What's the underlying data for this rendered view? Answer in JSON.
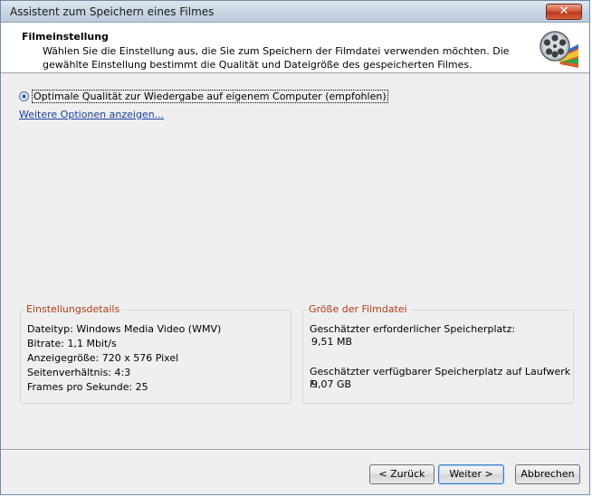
{
  "window": {
    "title": "Assistent zum Speichern eines Filmes",
    "close_label": "✕"
  },
  "header": {
    "title": "Filmeinstellung",
    "description": "Wählen Sie die Einstellung aus, die Sie zum Speichern der Filmdatei verwenden möchten. Die gewählte Einstellung bestimmt die Qualität und Dateigröße des gespeicherten Filmes."
  },
  "option": {
    "label": "Optimale Qualität zur Wiedergabe auf eigenem Computer (empfohlen)",
    "selected": true
  },
  "more_link": "Weitere Optionen anzeigen...",
  "details": {
    "title": "Einstellungsdetails",
    "lines": [
      "Dateityp: Windows Media Video (WMV)",
      "Bitrate: 1,1 Mbit/s",
      "Anzeigegröße: 720 x 576 Pixel",
      "Seitenverhältnis: 4:3",
      "Frames pro Sekunde: 25"
    ]
  },
  "filesize": {
    "title": "Größe der Filmdatei",
    "required_label": "Geschätzter erforderlicher Speicherplatz:",
    "required_value": "9,51 MB",
    "available_label": "Geschätzter verfügbarer Speicherplatz auf Laufwerk F:",
    "available_value": "9,07 GB"
  },
  "buttons": {
    "back": "< Zurück",
    "next": "Weiter >",
    "cancel": "Abbrechen"
  },
  "colors": {
    "group_title": "#b23a17",
    "link": "#1a3f9c"
  },
  "icons": {
    "header": "film-reel-icon",
    "close": "close-icon"
  }
}
